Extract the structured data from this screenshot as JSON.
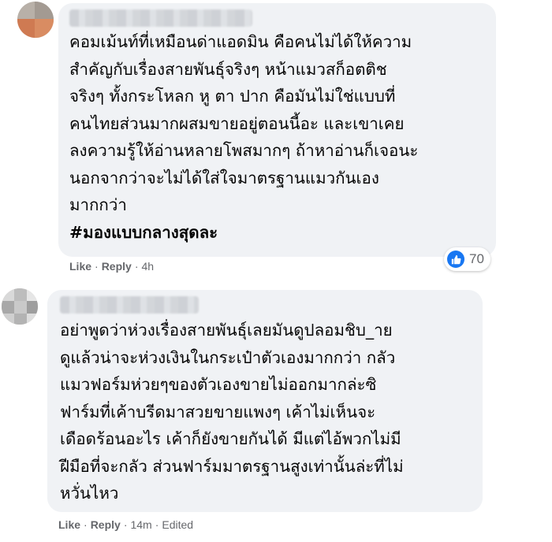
{
  "comments": [
    {
      "lines": [
        "คอมเม้นท์ที่เหมือนด่าแอดมิน คือคนไม่ได้ให้ความ",
        "สำคัญกับเรื่องสายพันธุ์จริงๆ หน้าแมวสก็อตติช",
        "จริงๆ ทั้งกระโหลก หู ตา ปาก คือมันไม่ใช่แบบที่",
        "คนไทยส่วนมากผสมขายอยู่ตอนนี้อะ และเขาเคย",
        "ลงความรู้ให้อ่านหลายโพสมากๆ ถ้าหาอ่านก็เจอนะ",
        "นอกจากว่าจะไม่ได้ใส่ใจมาตรฐานแมวกันเอง",
        "มากกว่า"
      ],
      "hashtag": "#มองแบบกลางสุดละ",
      "like_label": "Like",
      "reply_label": "Reply",
      "time": "4h",
      "reaction_count": "70",
      "reaction_icon": "like-icon"
    },
    {
      "lines": [
        "อย่าพูดว่าห่วงเรื่องสายพันธุ์เลยมันดูปลอมชิบ_าย",
        "ดูแล้วน่าจะห่วงเงินในกระเป๋าตัวเองมากกว่า กลัว",
        "แมวฟอร์มห่วยๆของตัวเองขายไม่ออกมากล่ะซิ",
        "ฟาร์มที่เค้าบรีดมาสวยขายแพงๆ เค้าไม่เห็นจะ",
        "เดือดร้อนอะไร เค้าก็ยังขายกันได้ มีแต่ไอ้พวกไม่มี",
        "ฝีมือที่จะกลัว ส่วนฟาร์มมาตรฐานสูงเท่านั้นล่ะที่ไม่",
        "หวั่นไหว"
      ],
      "like_label": "Like",
      "reply_label": "Reply",
      "time": "14m",
      "edited_label": "Edited"
    }
  ],
  "colors": {
    "bubble": "#f0f2f5",
    "meta_text": "#65676b",
    "like_blue": "#1877f2"
  }
}
